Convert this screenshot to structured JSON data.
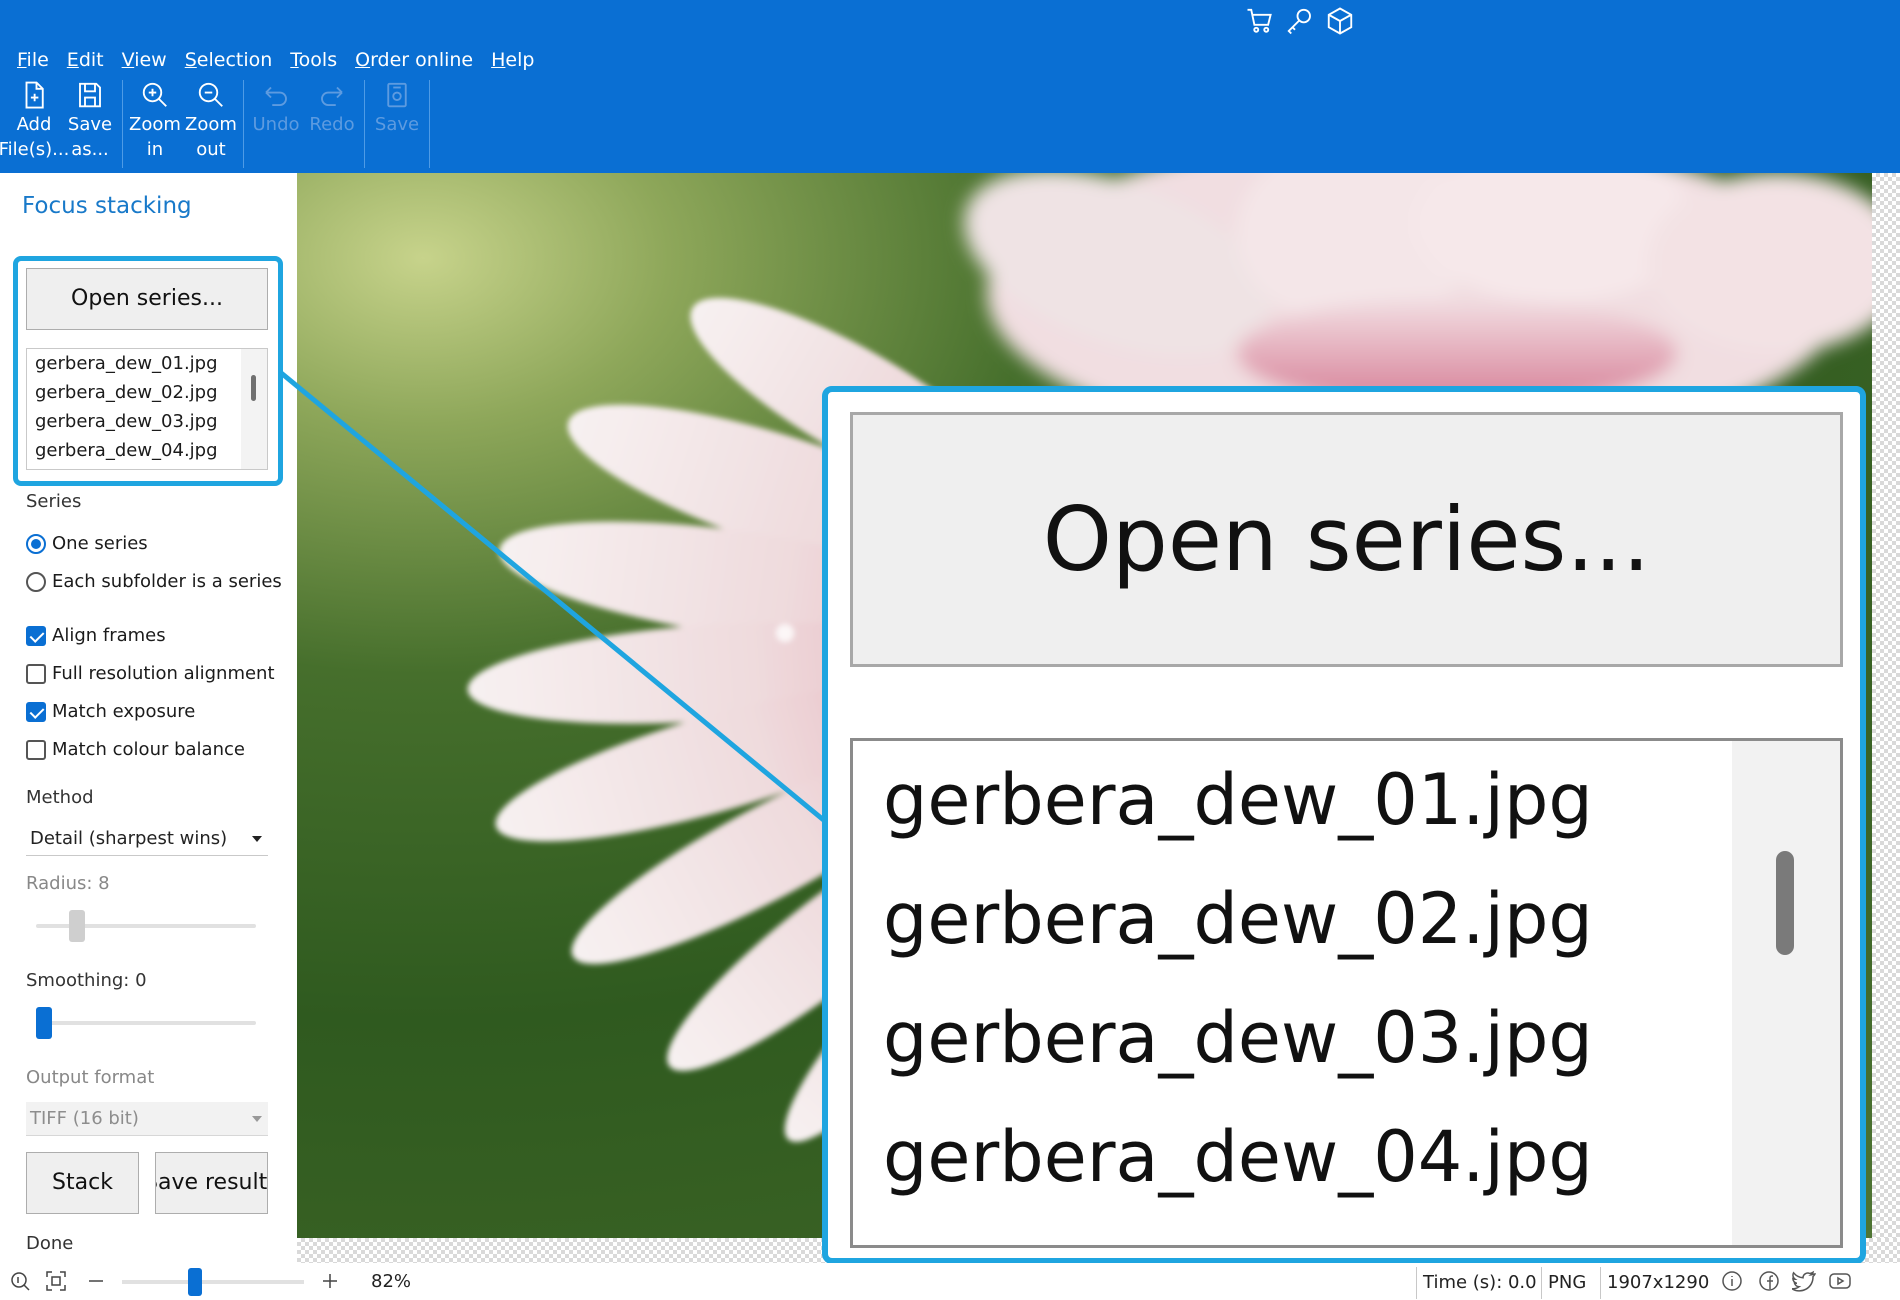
{
  "menu": [
    "File",
    "Edit",
    "View",
    "Selection",
    "Tools",
    "Order online",
    "Help"
  ],
  "top_icons": [
    "cart-icon",
    "key-icon",
    "box-icon"
  ],
  "toolbar": [
    {
      "label": "Add\nFile(s)...",
      "icon": "add-file-icon",
      "enabled": true
    },
    {
      "label": "Save\nas...",
      "icon": "floppy-icon",
      "enabled": true
    },
    {
      "label": "Zoom\nin",
      "icon": "zoom-in-icon",
      "enabled": true
    },
    {
      "label": "Zoom\nout",
      "icon": "zoom-out-icon",
      "enabled": true
    },
    {
      "label": "Undo",
      "icon": "undo-icon",
      "enabled": false
    },
    {
      "label": "Redo",
      "icon": "redo-icon",
      "enabled": false
    },
    {
      "label": "Save",
      "icon": "save-icon",
      "enabled": false
    }
  ],
  "panel": {
    "title": "Focus stacking",
    "open_series_label": "Open series...",
    "files": [
      "gerbera_dew_01.jpg",
      "gerbera_dew_02.jpg",
      "gerbera_dew_03.jpg",
      "gerbera_dew_04.jpg"
    ],
    "series_label": "Series",
    "radio_one": "One series",
    "radio_each": "Each subfolder is a series",
    "align_frames": "Align frames",
    "full_res": "Full resolution alignment",
    "match_exposure": "Match exposure",
    "match_colour": "Match colour balance",
    "method_label": "Method",
    "method_value": "Detail (sharpest wins)",
    "radius_label": "Radius: 8",
    "radius_value": 8,
    "smoothing_label": "Smoothing: 0",
    "smoothing_value": 0,
    "output_label": "Output format",
    "output_value": "TIFF (16 bit)",
    "stack_label": "Stack",
    "save_result_label": "Save result...",
    "status": "Done"
  },
  "statusbar": {
    "zoom": "82%",
    "time": "Time (s): 0.0",
    "format": "PNG",
    "dimensions": "1907x1290"
  },
  "colors": {
    "accent": "#0a6fd3",
    "highlight": "#1fa5e0"
  }
}
